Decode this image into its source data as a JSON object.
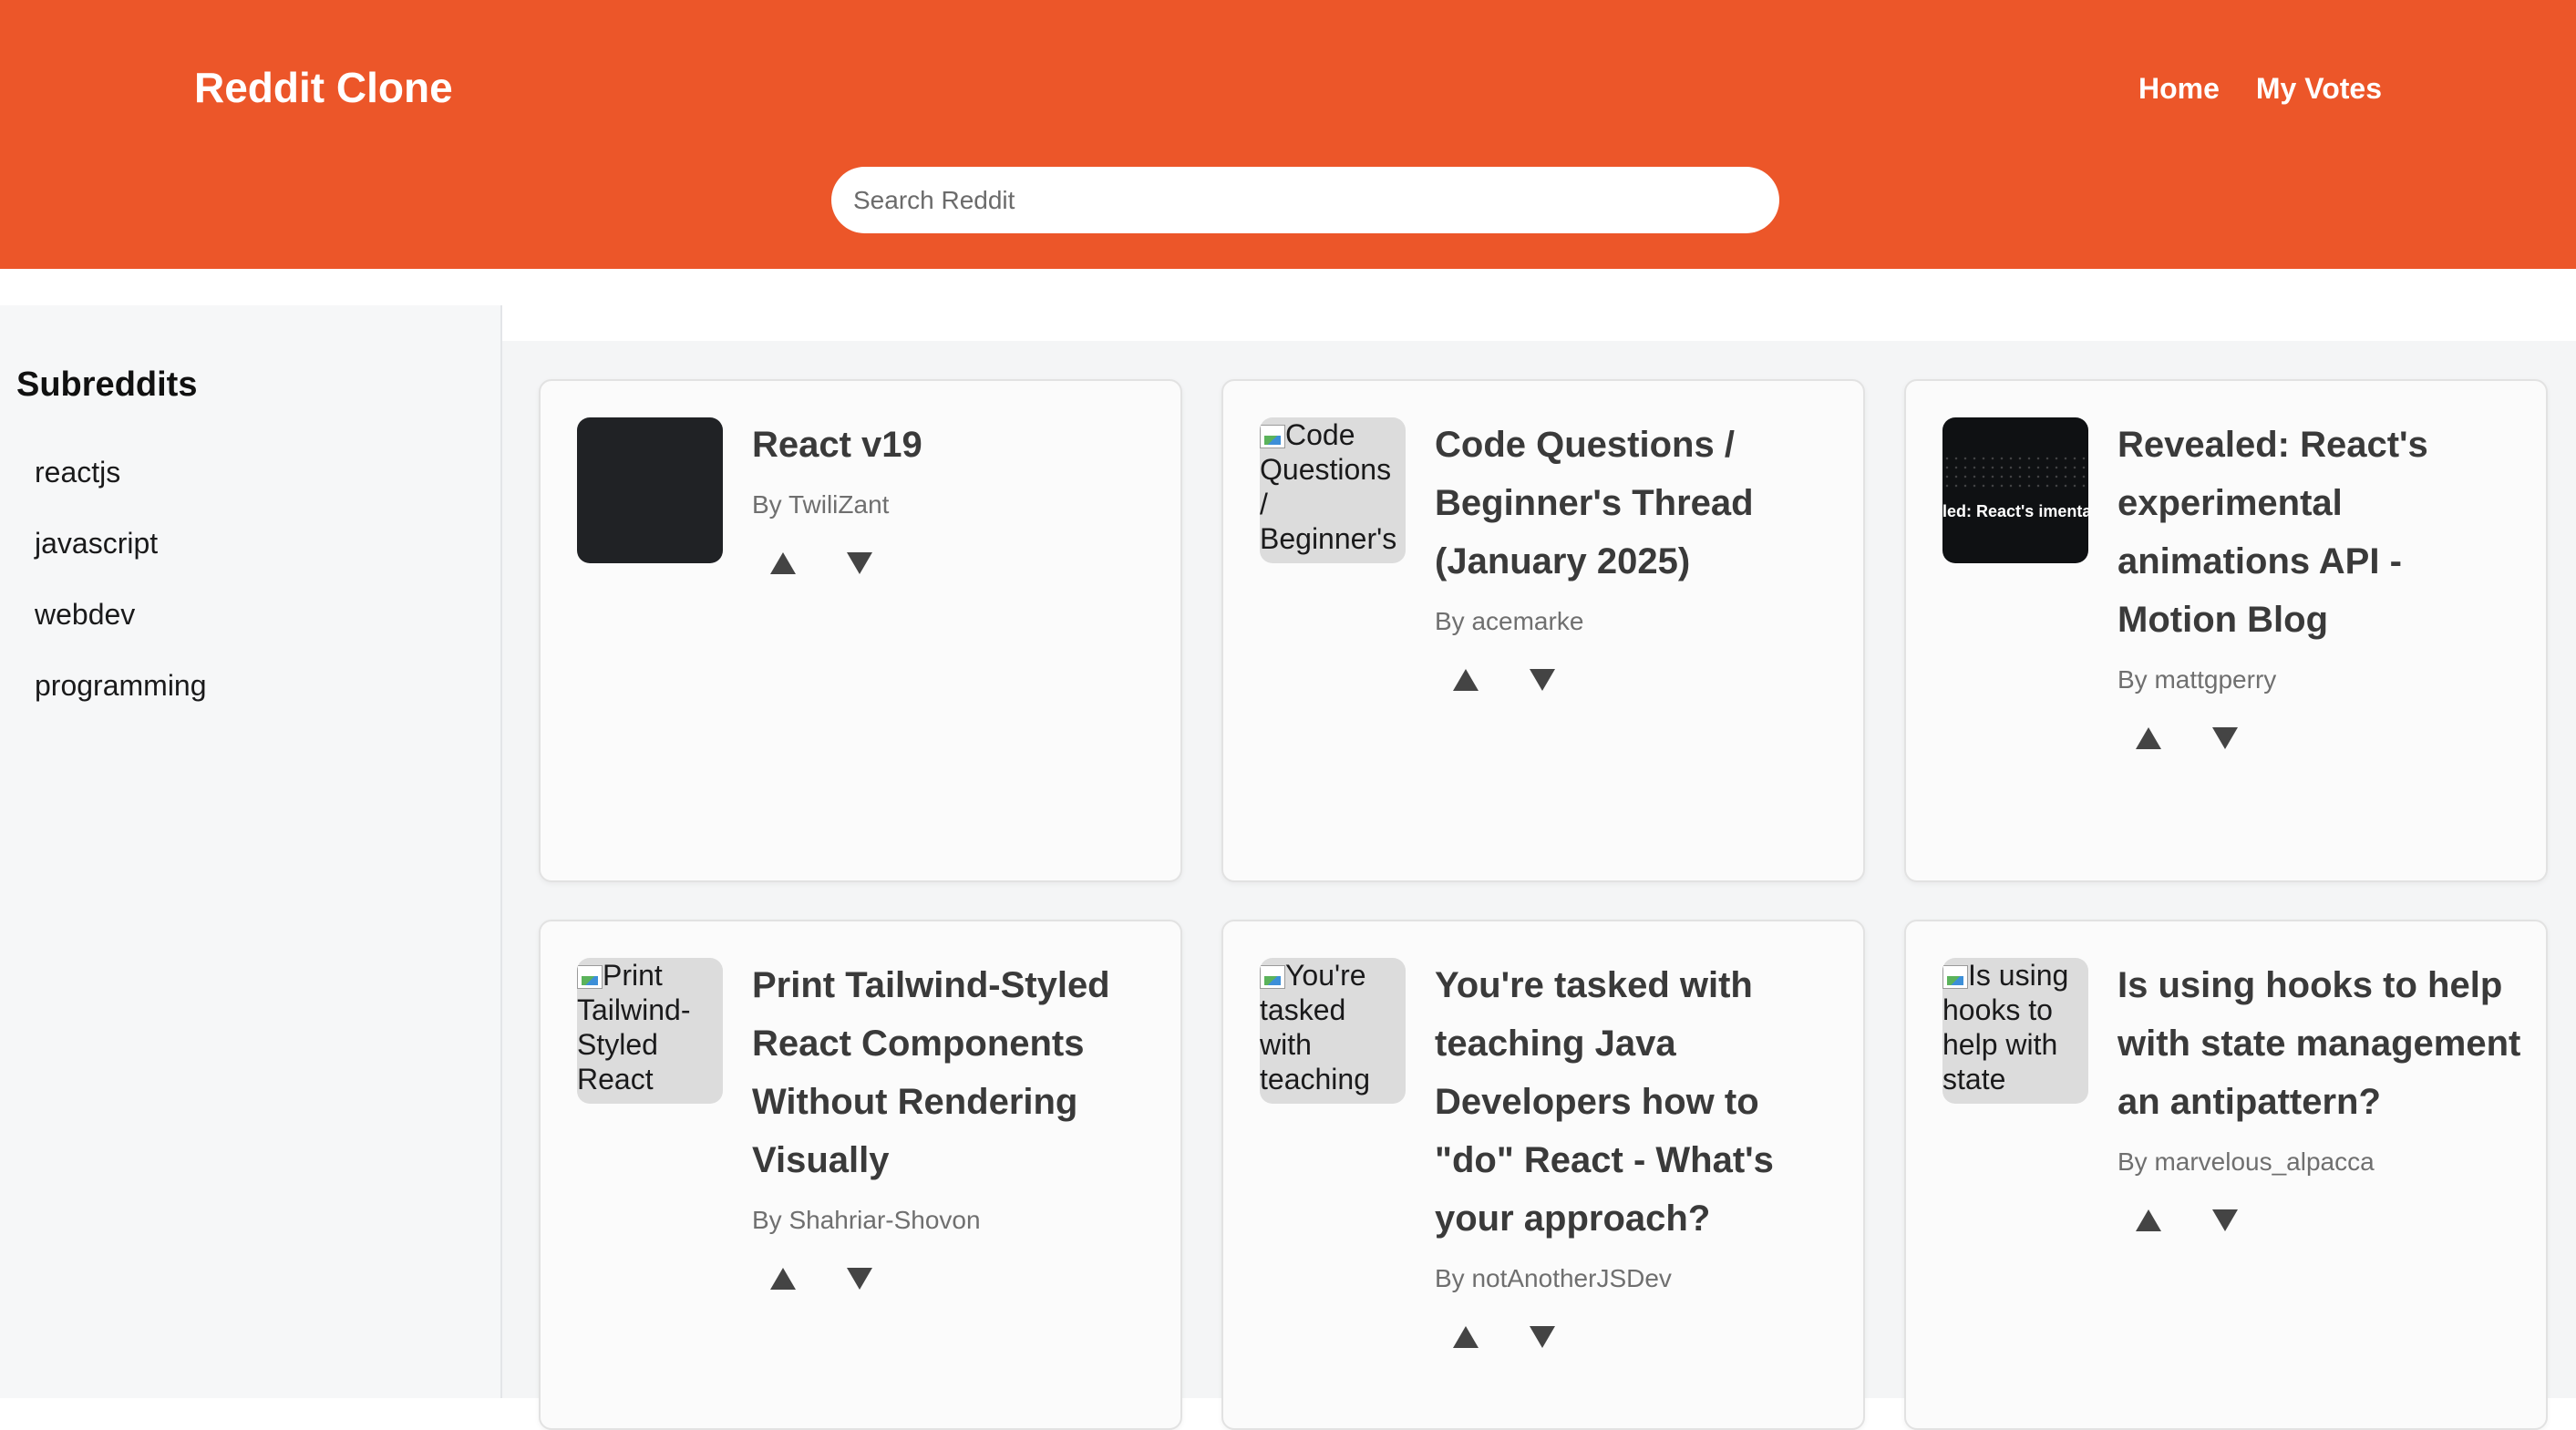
{
  "header": {
    "brand": "Reddit Clone",
    "nav": [
      "Home",
      "My Votes"
    ],
    "search_placeholder": "Search Reddit"
  },
  "sidebar": {
    "title": "Subreddits",
    "items": [
      "reactjs",
      "javascript",
      "webdev",
      "programming"
    ]
  },
  "posts": [
    {
      "title": "React v19",
      "author": "By TwiliZant",
      "thumb_alt": ""
    },
    {
      "title": "Code Questions / Beginner's Thread (January 2025)",
      "author": "By acemarke",
      "thumb_alt": "Code Questions / Beginner's"
    },
    {
      "title": "Revealed: React's experimental animations API - Motion Blog",
      "author": "By mattgperry",
      "thumb_caption": "led: React's imental animation"
    },
    {
      "title": "Print Tailwind-Styled React Components Without Rendering Visually",
      "author": "By Shahriar-Shovon",
      "thumb_alt": "Print Tailwind-Styled React"
    },
    {
      "title": "You're tasked with teaching Java Developers how to \"do\" React - What's your approach?",
      "author": "By notAnotherJSDev",
      "thumb_alt": "You're tasked with teaching"
    },
    {
      "title": "Is using hooks to help with state management an antipattern?",
      "author": "By marvelous_alpacca",
      "thumb_alt": "Is using hooks to help with state"
    }
  ],
  "icons": {
    "upvote": "upvote-triangle-icon",
    "downvote": "downvote-triangle-icon"
  },
  "colors": {
    "brand": "#ec5629",
    "vote_icon": "#444444"
  }
}
